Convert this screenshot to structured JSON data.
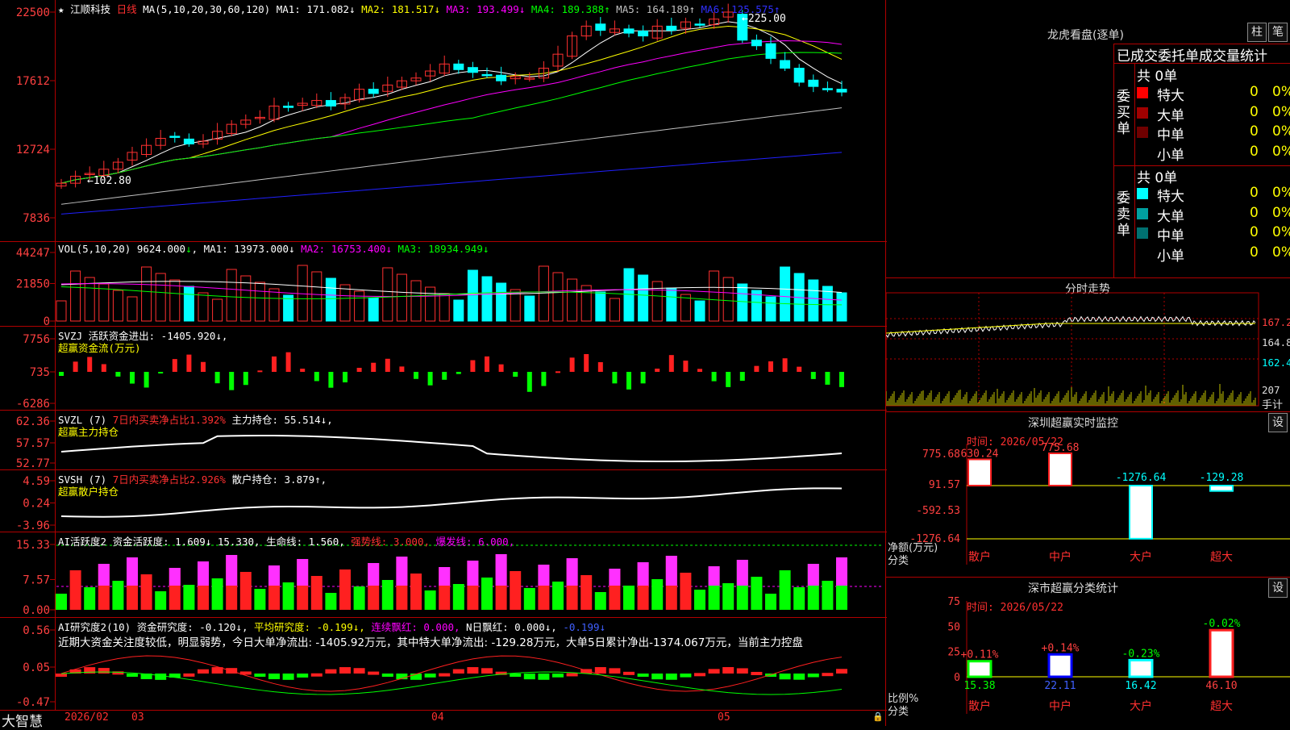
{
  "stock": {
    "name": "江顺科技",
    "star": "★",
    "period": "日线"
  },
  "main_chart": {
    "ma_header": "MA(5,10,20,30,60,120)",
    "mas": [
      {
        "label": "MA1:",
        "value": "171.082",
        "arrow": "↓",
        "color": "#ffffff"
      },
      {
        "label": "MA2:",
        "value": "181.517",
        "arrow": "↓",
        "color": "#ffff00"
      },
      {
        "label": "MA3:",
        "value": "193.499",
        "arrow": "↓",
        "color": "#ff00ff"
      },
      {
        "label": "MA4:",
        "value": "189.388",
        "arrow": "↑",
        "color": "#00ff00"
      },
      {
        "label": "MA5:",
        "value": "164.189",
        "arrow": "↑",
        "color": "#c0c0c0"
      },
      {
        "label": "MA6:",
        "value": "125.575",
        "arrow": "↑",
        "color": "#3030ff"
      }
    ],
    "y_ticks": [
      "22500",
      "17612",
      "12724",
      "7836"
    ],
    "high_label": "←225.00",
    "low_label": "←102.80"
  },
  "vol_panel": {
    "title": "VOL(5,10,20)",
    "value": "9624.000",
    "arrow": "↓",
    "mas": [
      {
        "label": "MA1:",
        "value": "13973.000",
        "arrow": "↓",
        "color": "#ffffff"
      },
      {
        "label": "MA2:",
        "value": "16753.400",
        "arrow": "↓",
        "color": "#ff00ff"
      },
      {
        "label": "MA3:",
        "value": "18934.949",
        "arrow": "↓",
        "color": "#00ff00"
      }
    ],
    "y_ticks": [
      "44247",
      "21850",
      "0"
    ]
  },
  "svzj_panel": {
    "line1": "SVZJ  活跃资金进出: -1405.920↓,",
    "line2": "超赢资金流(万元)",
    "y_ticks": [
      "7756",
      "735",
      "-6286"
    ]
  },
  "svzl_panel": {
    "prefix": "SVZL (7)",
    "red_text": "7日内买卖净占比1.392%",
    "suffix": "主力持仓: 55.514↓,",
    "line2": "超赢主力持仓",
    "y_ticks": [
      "62.36",
      "57.57",
      "52.77"
    ]
  },
  "svsh_panel": {
    "prefix": "SVSH (7)",
    "red_text": "7日内买卖净占比2.926%",
    "suffix": "散户持仓: 3.879↑,",
    "line2": "超赢散户持仓",
    "y_ticks": [
      "4.59",
      "0.24",
      "-3.96"
    ]
  },
  "ai_active_panel": {
    "title": "AI活跃度2",
    "items": [
      {
        "text": "资金活跃度: 1.609↓",
        "color": "#ffffff"
      },
      {
        "text": "15.330,",
        "color": "#ffffff"
      },
      {
        "text": "生命线: 1.560,",
        "color": "#ffffff"
      },
      {
        "text": "强势线: 3.000,",
        "color": "#ff3030"
      },
      {
        "text": "爆发线: 6.000,",
        "color": "#ff00ff"
      }
    ],
    "y_ticks": [
      "15.33",
      "7.57",
      "0.00"
    ]
  },
  "ai_research_panel": {
    "title": "AI研究度2(10)",
    "items": [
      {
        "text": "资金研究度: -0.120↓,",
        "color": "#ffffff"
      },
      {
        "text": "平均研究度: -0.199↓,",
        "color": "#ffff00"
      },
      {
        "text": "连续飘红: 0.000,",
        "color": "#ff00ff"
      },
      {
        "text": "N日飘红: 0.000↓,",
        "color": "#ffffff"
      },
      {
        "text": "-0.199↓",
        "color": "#4060ff"
      }
    ],
    "comment": "近期大资金关注度较低，明显弱势，今日大单净流出: -1405.92万元，其中特大单净流出: -129.28万元，大单5日累计净出-1374.067万元，当前主力控盘",
    "y_ticks": [
      "0.56",
      "0.05",
      "-0.47"
    ]
  },
  "bottom_bar": {
    "brand": "大智慧",
    "date": "2026/02",
    "months": [
      "03",
      "04",
      "05"
    ]
  },
  "dragon_tiger": {
    "title": "龙虎看盘(逐单)",
    "btn_bar": "柱",
    "btn_detail": "笔",
    "header": "已成交委托单成交量统计",
    "buy_label": "委买单",
    "sell_label": "委卖单",
    "buy_total": "共 0单",
    "sell_total": "共 0单",
    "buy_rows": [
      {
        "label": "特大",
        "count": "0",
        "pct": "0%",
        "color": "#ff0000"
      },
      {
        "label": "大单",
        "count": "0",
        "pct": "0%",
        "color": "#a00000"
      },
      {
        "label": "中单",
        "count": "0",
        "pct": "0%",
        "color": "#700000"
      },
      {
        "label": "小单",
        "count": "0",
        "pct": "0%",
        "color": ""
      }
    ],
    "sell_rows": [
      {
        "label": "特大",
        "count": "0",
        "pct": "0%",
        "color": "#00ffff"
      },
      {
        "label": "大单",
        "count": "0",
        "pct": "0%",
        "color": "#00a0a0"
      },
      {
        "label": "中单",
        "count": "0",
        "pct": "0%",
        "color": "#007070"
      },
      {
        "label": "小单",
        "count": "0",
        "pct": "0%",
        "color": ""
      }
    ]
  },
  "intraday": {
    "title": "分时走势",
    "y_ticks": [
      "167.2",
      "164.8",
      "162.4"
    ],
    "vol_max": "207",
    "vol_unit": "手计"
  },
  "monitor": {
    "title": "深圳超赢实时监控",
    "btn": "设",
    "time": "时间: 2026/05/22",
    "y_ticks": [
      "775.68",
      "91.57",
      "-592.53",
      "-1276.64"
    ],
    "ylabel": "净额(万元)",
    "xlabel": "分类",
    "categories": [
      "散户",
      "中户",
      "大户",
      "超大"
    ],
    "values": [
      "630.24",
      "775.68",
      "-1276.64",
      "-129.28"
    ]
  },
  "classify": {
    "title": "深市超赢分类统计",
    "btn": "设",
    "time": "时间: 2026/05/22",
    "y_ticks": [
      "75",
      "50",
      "25",
      "0"
    ],
    "ylabel": "比例%",
    "xlabel": "分类",
    "categories": [
      "散户",
      "中户",
      "大户",
      "超大"
    ],
    "values": [
      "15.38",
      "22.11",
      "16.42",
      "46.10"
    ],
    "changes": [
      "+0.11%",
      "+0.14%",
      "-0.23%",
      "-0.02%"
    ]
  },
  "chart_data": [
    {
      "type": "candlestick",
      "title": "江顺科技 日线",
      "ylim": [
        7836,
        22500
      ],
      "close_approx": [
        103,
        108,
        110,
        113,
        118,
        125,
        130,
        135,
        136,
        131,
        133,
        140,
        145,
        148,
        150,
        158,
        157,
        160,
        162,
        158,
        164,
        170,
        167,
        173,
        176,
        178,
        183,
        188,
        184,
        182,
        180,
        176,
        179,
        178,
        185,
        195,
        208,
        215,
        212,
        213,
        210,
        208,
        215,
        212,
        218,
        216,
        220,
        225,
        205,
        201,
        192,
        185,
        175,
        172,
        170,
        168
      ]
    },
    {
      "type": "bar",
      "title": "VOL(5,10,20)",
      "ylim": [
        0,
        44247
      ],
      "last_value": 9624
    },
    {
      "type": "bar",
      "title": "超赢资金流(万元)",
      "ylim": [
        -6286,
        7756
      ],
      "last_value": -1405.92
    },
    {
      "type": "line",
      "title": "超赢主力持仓",
      "ylim": [
        52.77,
        62.36
      ],
      "last_value": 55.514
    },
    {
      "type": "line",
      "title": "超赢散户持仓",
      "ylim": [
        -3.96,
        4.59
      ],
      "last_value": 3.879
    },
    {
      "type": "bar",
      "title": "AI活跃度2",
      "ylim": [
        0,
        15.33
      ],
      "last_value": 1.609
    },
    {
      "type": "bar",
      "title": "AI研究度2(10)",
      "ylim": [
        -0.47,
        0.56
      ],
      "last_value": -0.12
    },
    {
      "type": "bar",
      "title": "深圳超赢实时监控",
      "categories": [
        "散户",
        "中户",
        "大户",
        "超大"
      ],
      "values": [
        630.24,
        775.68,
        -1276.64,
        -129.28
      ],
      "ylim": [
        -1276.64,
        775.68
      ]
    },
    {
      "type": "bar",
      "title": "深市超赢分类统计",
      "categories": [
        "散户",
        "中户",
        "大户",
        "超大"
      ],
      "values": [
        15.38,
        22.11,
        16.42,
        46.1
      ],
      "ylim": [
        0,
        75
      ]
    }
  ]
}
